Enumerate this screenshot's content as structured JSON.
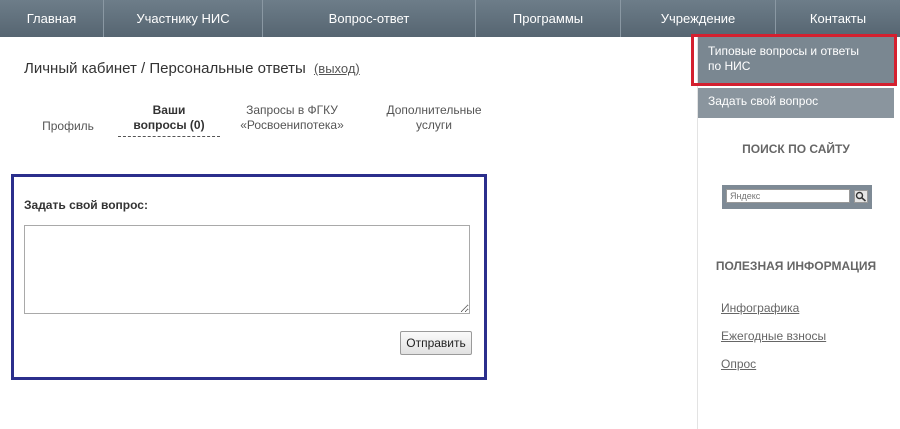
{
  "nav": {
    "items": [
      {
        "label": "Главная"
      },
      {
        "label": "Участнику НИС"
      },
      {
        "label": "Вопрос-ответ"
      },
      {
        "label": "Программы"
      },
      {
        "label": "Учреждение"
      },
      {
        "label": "Контакты"
      }
    ]
  },
  "main": {
    "title": "Личный кабинет / Персональные ответы",
    "logout_label": "(выход)",
    "tabs": [
      {
        "label_line1": "Профиль",
        "label_line2": ""
      },
      {
        "label_line1": "Ваши",
        "label_line2": "вопросы (0)"
      },
      {
        "label_line1": "Запросы в ФГКУ",
        "label_line2": "«Росвоенипотека»"
      },
      {
        "label_line1": "Дополнительные",
        "label_line2": "услуги"
      }
    ],
    "active_tab": "Ваши вопросы (0)",
    "question_form": {
      "label": "Задать свой вопрос:",
      "textarea_value": "",
      "submit_label": "Отправить"
    }
  },
  "sidebar": {
    "typical_qa_line1": "Типовые вопросы и ответы",
    "typical_qa_line2": "по НИС",
    "ask_question": "Задать свой вопрос",
    "search_title": "ПОИСК ПО САЙТУ",
    "search_placeholder": "Яндекс",
    "info_title": "ПОЛЕЗНАЯ ИНФОРМАЦИЯ",
    "info_links": [
      {
        "label": "Инфографика"
      },
      {
        "label": "Ежегодные взносы"
      },
      {
        "label": "Опрос"
      }
    ]
  },
  "colors": {
    "nav_bg": "#5f6f7c",
    "highlight_red": "#d4202f",
    "form_border_blue": "#2b2f8c",
    "sidebar_button_bg": "#7a8791"
  }
}
